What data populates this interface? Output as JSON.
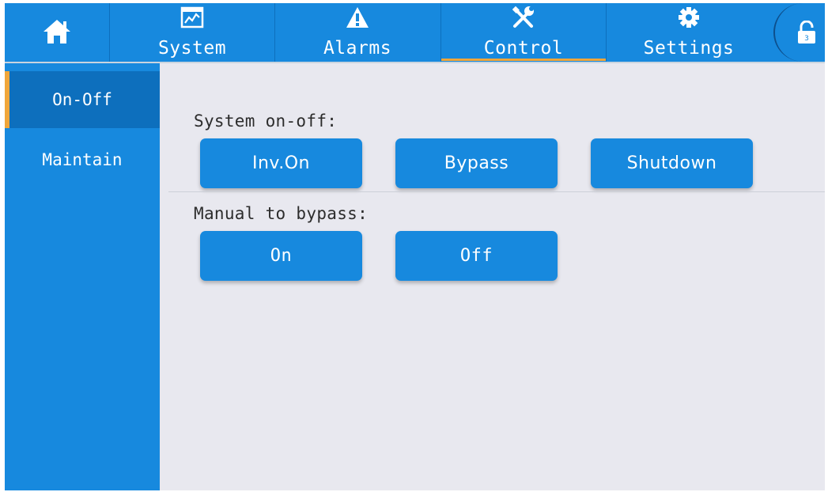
{
  "nav": {
    "home_icon": "home-icon",
    "tabs": [
      {
        "label": "System",
        "icon": "chart-monitor-icon"
      },
      {
        "label": "Alarms",
        "icon": "warning-icon"
      },
      {
        "label": "Control",
        "icon": "tools-icon",
        "active": true
      },
      {
        "label": "Settings",
        "icon": "gear-icon"
      }
    ],
    "lock_icon": "unlock-icon",
    "lock_level": "3"
  },
  "sidebar": {
    "items": [
      {
        "label": "On-Off",
        "active": true
      },
      {
        "label": "Maintain",
        "active": false
      }
    ]
  },
  "main": {
    "system_onoff": {
      "label": "System on-off:",
      "buttons": [
        "Inv.On",
        "Bypass",
        "Shutdown"
      ]
    },
    "manual_bypass": {
      "label": "Manual to bypass:",
      "buttons": [
        "On",
        "Off"
      ]
    }
  },
  "colors": {
    "primary": "#1789de",
    "primary_dark": "#0d6fbd",
    "accent": "#f0a63a",
    "background": "#e8e8ef"
  }
}
